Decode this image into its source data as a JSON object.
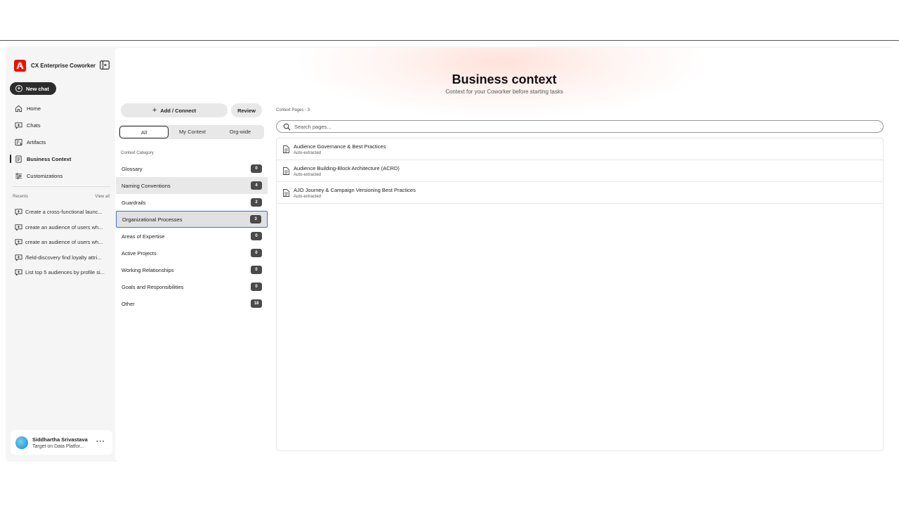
{
  "app": {
    "name": "CX Enterprise Coworker",
    "new_chat_label": "New chat"
  },
  "nav": {
    "items": [
      {
        "label": "Home",
        "icon": "home-icon"
      },
      {
        "label": "Chats",
        "icon": "chats-icon"
      },
      {
        "label": "Artifacts",
        "icon": "artifacts-icon"
      },
      {
        "label": "Business Context",
        "icon": "business-context-icon",
        "active": true
      },
      {
        "label": "Customizations",
        "icon": "sliders-icon"
      }
    ]
  },
  "recents": {
    "heading": "Recents",
    "view_all": "View all",
    "items": [
      "Create a cross-functional launc...",
      "create an audience of users wh...",
      "create an audience of users wh...",
      "/field-discovery find loyalty attri...",
      "List top 5 audiences by profile si..."
    ]
  },
  "user": {
    "name": "Siddhartha Srivastava",
    "subtitle": "Target on Data Platfor..."
  },
  "header": {
    "title": "Business context",
    "subtitle": "Context for your Coworker before starting tasks"
  },
  "actions": {
    "add_connect": "Add / Connect",
    "review": "Review"
  },
  "filter_tabs": [
    "All",
    "My Context",
    "Org-wide"
  ],
  "categories": {
    "label": "Context Category",
    "items": [
      {
        "label": "Glossary",
        "count": "0"
      },
      {
        "label": "Naming Conventions",
        "count": "4"
      },
      {
        "label": "Guardrails",
        "count": "2"
      },
      {
        "label": "Organizational Processes",
        "count": "3",
        "selected": true
      },
      {
        "label": "Areas of Expertise",
        "count": "0"
      },
      {
        "label": "Active Projects",
        "count": "0"
      },
      {
        "label": "Working Relationships",
        "count": "0"
      },
      {
        "label": "Goals and Responsibilities",
        "count": "0"
      },
      {
        "label": "Other",
        "count": "18"
      }
    ]
  },
  "pages": {
    "label": "Context Pages - 3",
    "search_placeholder": "Search pages...",
    "items": [
      {
        "title": "Audience Governance & Best Practices",
        "source": "Auto-extracted"
      },
      {
        "title": "Audience Building-Block Architecture (ACRD)",
        "source": "Auto-extracted"
      },
      {
        "title": "AJO Journey & Campaign Versioning Best Practices",
        "source": "Auto-extracted"
      }
    ]
  },
  "colors": {
    "brand": "#eb1000",
    "selected_border": "#3b73c4",
    "dark_button": "#2c2c2c"
  }
}
